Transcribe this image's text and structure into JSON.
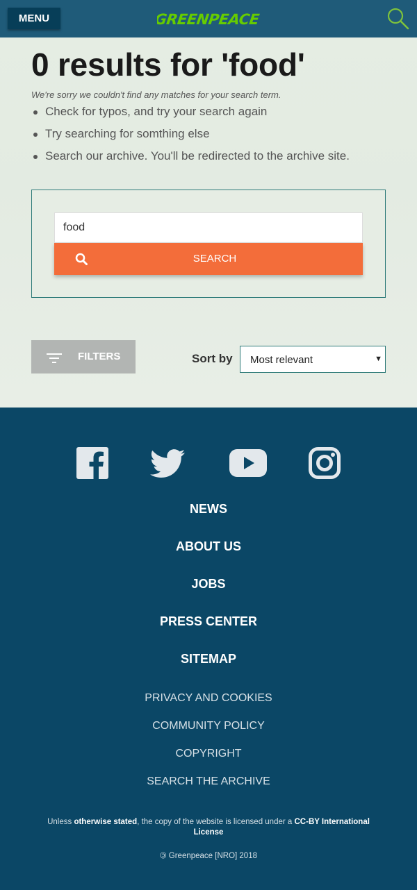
{
  "header": {
    "menu_label": "MENU",
    "logo_text": "GREENPEACE",
    "logo_color": "#66cc00"
  },
  "results": {
    "title": "0 results for 'food'",
    "sorry_text": "We're sorry we couldn't find any matches for your search term.",
    "tips": [
      "Check for typos, and try your search again",
      "Try searching for somthing else",
      "Search our archive. You'll be redirected to the archive site."
    ]
  },
  "search": {
    "input_value": "food",
    "button_label": "SEARCH",
    "button_color": "#f36d3a"
  },
  "filters": {
    "label": "FILTERS",
    "sort_label": "Sort by",
    "sort_value": "Most relevant"
  },
  "footer": {
    "social_icons": [
      "facebook-icon",
      "twitter-icon",
      "youtube-icon",
      "instagram-icon"
    ],
    "main_links": [
      "NEWS",
      "ABOUT US",
      "JOBS",
      "PRESS CENTER",
      "SITEMAP"
    ],
    "sub_links": [
      "PRIVACY AND COOKIES",
      "COMMUNITY POLICY",
      "COPYRIGHT",
      "SEARCH THE ARCHIVE"
    ],
    "license_prefix": "Unless ",
    "license_bold_1": "otherwise stated",
    "license_middle": ", the copy of the website is licensed under a ",
    "license_bold_2": "CC-BY International License",
    "copyright_text": "Greenpeace [NRO] 2018",
    "background": "#0b4766"
  }
}
